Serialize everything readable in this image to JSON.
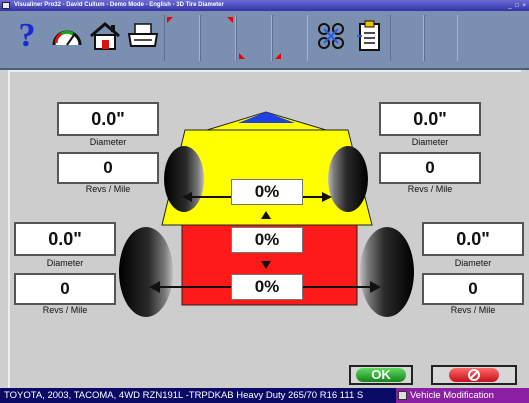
{
  "window": {
    "title": "Visualiner Pro32 - David Cullum - Demo Mode - English - 3D Tire Diameter"
  },
  "toolbar": {
    "icons": [
      "help-icon",
      "gauge-icon",
      "home-icon",
      "print-icon",
      "vehicle-specs-icon",
      "tire-diameter-icon"
    ],
    "help_glyph": "?"
  },
  "wheels": {
    "front_left": {
      "diameter": "0.0\"",
      "diameter_label": "Diameter",
      "revs": "0",
      "revs_label": "Revs / Mile"
    },
    "front_right": {
      "diameter": "0.0\"",
      "diameter_label": "Diameter",
      "revs": "0",
      "revs_label": "Revs / Mile"
    },
    "rear_left": {
      "diameter": "0.0\"",
      "diameter_label": "Diameter",
      "revs": "0",
      "revs_label": "Revs / Mile"
    },
    "rear_right": {
      "diameter": "0.0\"",
      "diameter_label": "Diameter",
      "revs": "0",
      "revs_label": "Revs / Mile"
    }
  },
  "differences": {
    "front_axle": "0%",
    "side_to_side": "0%",
    "rear_axle": "0%"
  },
  "buttons": {
    "ok_label": "OK"
  },
  "status": {
    "vehicle": "TOYOTA, 2003, TACOMA, 4WD RZN191L -TRPDKAB Heavy Duty 265/70 R16 111 S",
    "mode": "Vehicle Modification"
  },
  "colors": {
    "toolbar": "#7b8fb1",
    "yellow": "#ffff00",
    "red": "#ff1a1a",
    "blue_tip": "#1f3fe0",
    "status_bar": "#0a0a66",
    "mode_bg": "#8b1fa3"
  }
}
